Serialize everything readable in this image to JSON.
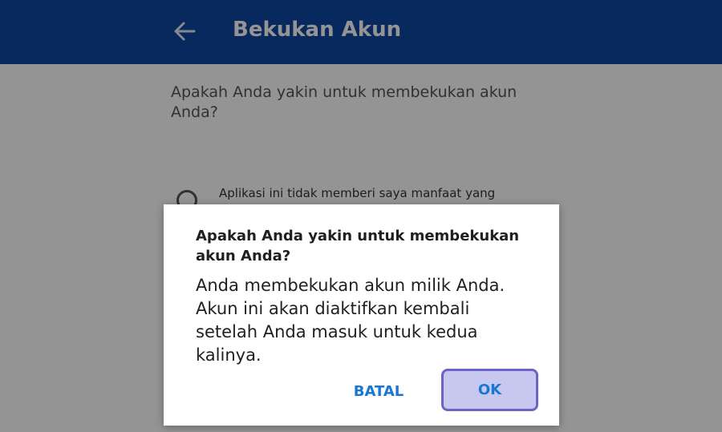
{
  "header": {
    "back_icon": "arrow-left-icon",
    "title": "Bekukan Akun",
    "color": "#0d47a1"
  },
  "page": {
    "question": "Apakah Anda yakin untuk membekukan akun Anda?",
    "options": [
      {
        "label": "Aplikasi ini tidak memberi saya manfaat yang"
      },
      {
        "label": ""
      }
    ]
  },
  "dialog": {
    "title": "Apakah Anda yakin untuk membekukan akun Anda?",
    "message": "Anda membekukan akun milik Anda. Akun ini akan diaktifkan kembali setelah Anda masuk untuk kedua kalinya.",
    "cancel_label": "BATAL",
    "ok_label": "OK",
    "button_color": "#1976d2",
    "ok_highlight_color": "#c7c8ef"
  }
}
